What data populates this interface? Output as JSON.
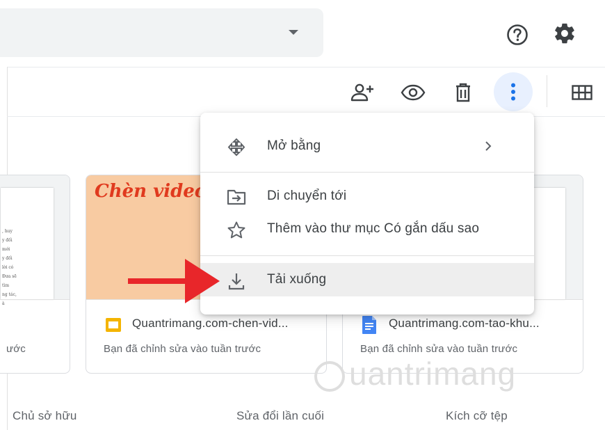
{
  "header": {
    "help_icon": "help-circle-icon",
    "settings_icon": "gear-icon"
  },
  "toolbar": {
    "share_icon": "person-add-icon",
    "preview_icon": "eye-icon",
    "trash_icon": "trash-icon",
    "more_icon": "more-vert-icon",
    "grid_icon": "grid-view-icon"
  },
  "context_menu": {
    "open_with": "Mở bằng",
    "move_to": "Di chuyển tới",
    "add_starred": "Thêm vào thư mục Có gắn dấu sao",
    "download": "Tải xuống"
  },
  "cards": [
    {
      "name": "",
      "meta": "ước",
      "snippet": [
        ", huy",
        "y đối",
        "mới",
        "y đối",
        "lời có",
        "Đưa sẽ",
        "tìm",
        "ng tác,",
        "à"
      ]
    },
    {
      "thumb_title": "Chèn video và",
      "name": "Quantrimang.com-chen-vid...",
      "meta": "Bạn đã chỉnh sửa vào tuần trước",
      "icon": "slides-icon",
      "thumb_color": "#f8cba2",
      "title_color": "#e03a1e"
    },
    {
      "name": "Quantrimang.com-tao-khu...",
      "meta": "Bạn đã chỉnh sửa vào tuần trước",
      "icon": "docs-icon"
    }
  ],
  "columns": {
    "owner": "Chủ sở hữu",
    "last_modified": "Sửa đổi lần cuối",
    "size": "Kích cỡ tệp"
  },
  "watermark": "uantrimang",
  "colors": {
    "arrow": "#e8262a",
    "more_button_bg": "#e8f0fe",
    "slides_yellow": "#f4b400",
    "docs_blue": "#4285f4"
  }
}
